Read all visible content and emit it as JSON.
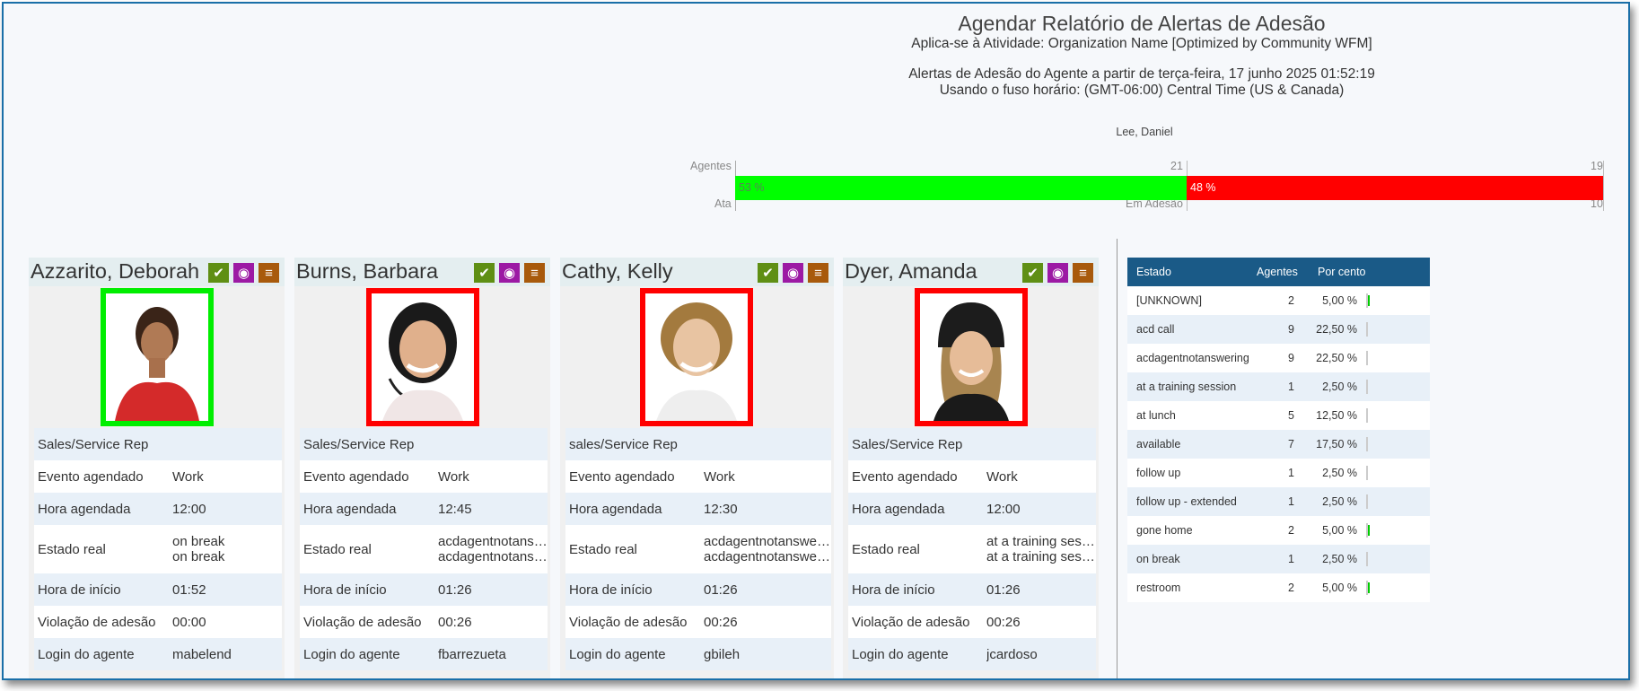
{
  "header": {
    "title": "Agendar Relatório de Alertas de Adesão",
    "activity": "Aplica-se à Atividade: Organization Name [Optimized by Community WFM]",
    "as_of": "Alertas de Adesão do Agente a partir de terça-feira, 17 junho 2025 01:52:19",
    "timezone": "Usando o fuso horário: (GMT-06:00) Central Time (US & Canada)"
  },
  "supervisor": "Lee, Daniel",
  "adherence_bar": {
    "label_top": "Agentes",
    "label_bottom": "Ata",
    "mid_top": "21",
    "mid_bottom": "Em Adesão",
    "end_top": "19",
    "end_bottom": "10",
    "green_label": "53 %",
    "red_label": "48 %",
    "green_fraction": 0.52,
    "colors": {
      "green": "#00ff00",
      "red": "#ff0000"
    }
  },
  "row_labels": {
    "event": "Evento agendado",
    "time": "Hora agendada",
    "state": "Estado real",
    "start": "Hora de início",
    "violation": "Violação de adesão",
    "login": "Login do agente"
  },
  "icons": [
    "check-icon",
    "eye-icon",
    "message-icon"
  ],
  "agents": [
    {
      "name": "Azzarito, Deborah",
      "adherent": true,
      "role": "Sales/Service Rep",
      "event": "Work",
      "time": "12:00",
      "state1": "on break",
      "state2": "on break",
      "start": "01:52",
      "violation": "00:00",
      "login": "mabelend"
    },
    {
      "name": "Burns, Barbara",
      "adherent": false,
      "role": "Sales/Service Rep",
      "event": "Work",
      "time": "12:45",
      "state1": "acdagentnotanswering",
      "state2": "acdagentnotanswering",
      "start": "01:26",
      "violation": "00:26",
      "login": "fbarrezueta"
    },
    {
      "name": "Cathy, Kelly",
      "adherent": false,
      "role": "sales/Service Rep",
      "event": "Work",
      "time": "12:30",
      "state1": "acdagentnotanswering",
      "state2": "acdagentnotanswering",
      "start": "01:26",
      "violation": "00:26",
      "login": "gbileh"
    },
    {
      "name": "Dyer, Amanda",
      "adherent": false,
      "role": "Sales/Service Rep",
      "event": "Work",
      "time": "12:00",
      "state1": "at a training session",
      "state2": "at a training session",
      "start": "01:26",
      "violation": "00:26",
      "login": "jcardoso"
    }
  ],
  "state_table": {
    "headers": {
      "state": "Estado",
      "agents": "Agentes",
      "percent": "Por cento"
    },
    "rows": [
      {
        "state": "[UNKNOWN]",
        "agents": "2",
        "percent": "5,00 %",
        "fill": 0.05
      },
      {
        "state": "acd call",
        "agents": "9",
        "percent": "22,50 %",
        "fill": 0
      },
      {
        "state": "acdagentnotanswering",
        "agents": "9",
        "percent": "22,50 %",
        "fill": 0
      },
      {
        "state": "at a training session",
        "agents": "1",
        "percent": "2,50 %",
        "fill": 0
      },
      {
        "state": "at lunch",
        "agents": "5",
        "percent": "12,50 %",
        "fill": 0
      },
      {
        "state": "available",
        "agents": "7",
        "percent": "17,50 %",
        "fill": 0
      },
      {
        "state": "follow up",
        "agents": "1",
        "percent": "2,50 %",
        "fill": 0
      },
      {
        "state": "follow up - extended",
        "agents": "1",
        "percent": "2,50 %",
        "fill": 0
      },
      {
        "state": "gone home",
        "agents": "2",
        "percent": "5,00 %",
        "fill": 0.05
      },
      {
        "state": "on break",
        "agents": "1",
        "percent": "2,50 %",
        "fill": 0
      },
      {
        "state": "restroom",
        "agents": "2",
        "percent": "5,00 %",
        "fill": 0.05
      }
    ]
  }
}
